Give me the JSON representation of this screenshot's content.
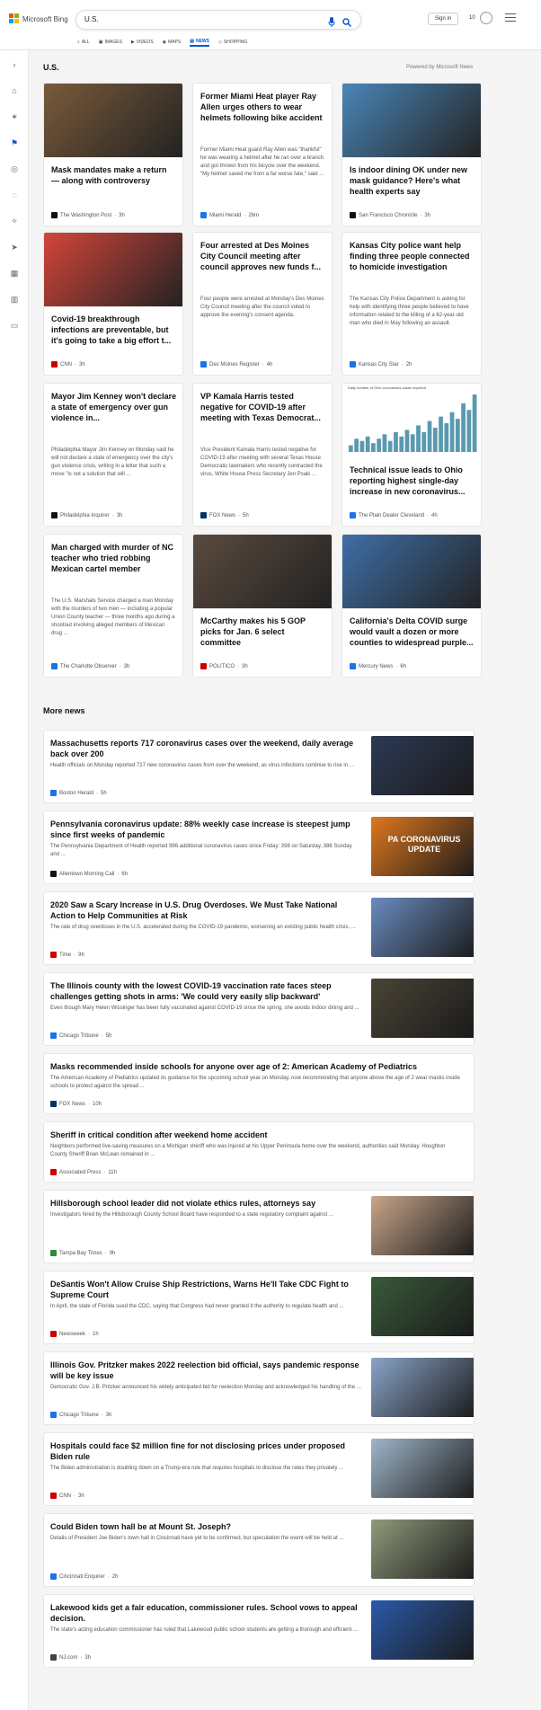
{
  "header": {
    "brand": "Microsoft Bing",
    "search_query": "U.S.",
    "signin_label": "Sign in",
    "rewards_count": "10",
    "tabs": [
      {
        "label": "ALL",
        "icon": "search-icon"
      },
      {
        "label": "IMAGES",
        "icon": "image-icon"
      },
      {
        "label": "VIDEOS",
        "icon": "video-icon"
      },
      {
        "label": "MAPS",
        "icon": "map-pin-icon"
      },
      {
        "label": "NEWS",
        "icon": "news-icon",
        "active": true
      },
      {
        "label": "SHOPPING",
        "icon": "tag-icon"
      }
    ]
  },
  "rail": [
    "chevron-right-icon",
    "home-icon",
    "compass-icon",
    "flag-icon",
    "location-icon",
    "globe-icon",
    "lightbulb-icon",
    "rocket-icon",
    "film-icon",
    "bank-icon",
    "card-icon"
  ],
  "section": {
    "title": "U.S.",
    "powered_by": "Powered by Microsoft News"
  },
  "cards": [
    {
      "title": "Mask mandates make a return — along with controversy",
      "snippet": "",
      "source": "The Washington Post",
      "time": "3h",
      "image": true,
      "color": "#7a5a3a",
      "logo_color": "#111"
    },
    {
      "title": "Former Miami Heat player Ray Allen urges others to wear helmets following bike accident",
      "snippet": "Former Miami Heat guard Ray Allen was \"thankful\" he was wearing a helmet after he ran over a branch and got thrown from his bicycle over the weekend. \"My helmet saved me from a far worse fate,\" said ...",
      "source": "Miami Herald",
      "time": "26m",
      "image": false,
      "logo_color": "#1a73e8"
    },
    {
      "title": "Is indoor dining OK under new mask guidance? Here's what health experts say",
      "snippet": "",
      "source": "San Francisco Chronicle",
      "time": "3h",
      "image": true,
      "color": "#4a86b8",
      "logo_color": "#111"
    },
    {
      "title": "Covid-19 breakthrough infections are preventable, but it's going to take a big effort t...",
      "snippet": "",
      "source": "CNN",
      "time": "3h",
      "image": true,
      "color": "#d4453a",
      "logo_color": "#cc0000"
    },
    {
      "title": "Four arrested at Des Moines City Council meeting after council approves new funds f...",
      "snippet": "Four people were arrested at Monday's Des Moines City Council meeting after the council voted to approve the evening's consent agenda.",
      "source": "Des Moines Register",
      "time": "4h",
      "image": false,
      "logo_color": "#1a73e8"
    },
    {
      "title": "Kansas City police want help finding three people connected to homicide investigation",
      "snippet": "The Kansas City Police Department is asking for help with identifying three people believed to have information related to the killing of a 62-year-old man who died in May following an assault.",
      "source": "Kansas City Star",
      "time": "2h",
      "image": false,
      "logo_color": "#1a73e8"
    },
    {
      "title": "Mayor Jim Kenney won't declare a state of emergency over gun violence in...",
      "snippet": "Philadelphia Mayor Jim Kenney on Monday said he will not declare a state of emergency over the city's gun violence crisis, writing in a letter that such a move \"is not a solution that will ...",
      "source": "Philadelphia Inquirer",
      "time": "3h",
      "image": false,
      "logo_color": "#111"
    },
    {
      "title": "VP Kamala Harris tested negative for COVID-19 after meeting with Texas Democrat...",
      "snippet": "Vice President Kamala Harris tested negative for COVID-19 after meeting with several Texas House Democratic lawmakers who recently contracted the virus, White House Press Secretary Jen Psaki ...",
      "source": "FOX News",
      "time": "5h",
      "image": false,
      "logo_color": "#003366"
    },
    {
      "title": "Technical issue leads to Ohio reporting highest single-day increase in new coronavirus...",
      "snippet": "",
      "source": "The Plain Dealer Cleveland",
      "time": "4h",
      "image": true,
      "chart": true,
      "chart_caption": "Daily number of Ohio coronavirus cases reported",
      "logo_color": "#1a73e8"
    },
    {
      "title": "Man charged with murder of NC teacher who tried robbing Mexican cartel member",
      "snippet": "The U.S. Marshals Service charged a man Monday with the murders of two men — including a popular Union County teacher — three months ago during a shootout involving alleged members of Mexican drug ...",
      "source": "The Charlotte Observer",
      "time": "3h",
      "image": false,
      "logo_color": "#1a73e8"
    },
    {
      "title": "McCarthy makes his 5 GOP picks for Jan. 6 select committee",
      "snippet": "",
      "source": "POLITICO",
      "time": "3h",
      "image": true,
      "color": "#5a4a3e",
      "logo_color": "#cc0000"
    },
    {
      "title": "California's Delta COVID surge would vault a dozen or more counties to widespread purple...",
      "snippet": "",
      "source": "Mercury News",
      "time": "6h",
      "image": true,
      "color": "#3f6fa8",
      "logo_color": "#1a73e8"
    }
  ],
  "more_news": {
    "title": "More news",
    "items": [
      {
        "title": "Massachusetts reports 717 coronavirus cases over the weekend, daily average back over 200",
        "snippet": "Health officials on Monday reported 717 new coronavirus cases from over the weekend, as virus infections continue to rise in ...",
        "source": "Boston Herald",
        "time": "5h",
        "image": true,
        "color": "#2d3a55",
        "logo_color": "#1a73e8"
      },
      {
        "title": "Pennsylvania coronavirus update: 88% weekly case increase is steepest jump since first weeks of pandemic",
        "snippet": "The Pennsylvania Department of Health reported 996 additional coronavirus cases since Friday: 398 on Saturday, 386 Sunday and ...",
        "source": "Allentown Morning Call",
        "time": "6h",
        "image": true,
        "color": "#e0781e",
        "thumb_text": "PA CORONAVIRUS UPDATE",
        "logo_color": "#111"
      },
      {
        "title": "2020 Saw a Scary Increase in U.S. Drug Overdoses. We Must Take National Action to Help Communities at Risk",
        "snippet": "The rate of drug overdoses in the U.S. accelerated during the COVID-19 pandemic, worsening an existing public health crisis, ...",
        "source": "Time",
        "time": "9h",
        "image": true,
        "color": "#6a8cc0",
        "logo_color": "#cc0000"
      },
      {
        "title": "The Illinois county with the lowest COVID-19 vaccination rate faces steep challenges getting shots in arms: 'We could very easily slip backward'",
        "snippet": "Even though Mary Helen Wissinger has been fully vaccinated against COVID-19 since the spring, she avoids indoor dining and ...",
        "source": "Chicago Tribune",
        "time": "5h",
        "image": true,
        "color": "#4a4436",
        "logo_color": "#1a73e8"
      },
      {
        "title": "Masks recommended inside schools for anyone over age of 2: American Academy of Pediatrics",
        "snippet": "The American Academy of Pediatrics updated its guidance for the upcoming school year on Monday, now recommending that anyone above the age of 2 wear masks inside schools to protect against the spread ...",
        "source": "FOX News",
        "time": "10h",
        "image": false,
        "logo_color": "#003366"
      },
      {
        "title": "Sheriff in critical condition after weekend home accident",
        "snippet": "Neighbors performed live-saving measures on a Michigan sheriff who was injured at his Upper Peninsula home over the weekend, authorities said Monday. Houghton County Sheriff Brian McLean remained in ...",
        "source": "Associated Press",
        "time": "11h",
        "image": false,
        "logo_color": "#cc0000"
      },
      {
        "title": "Hillsborough school leader did not violate ethics rules, attorneys say",
        "snippet": "Investigators hired by the Hillsborough County School Board have responded to a state regulatory complaint against ...",
        "source": "Tampa Bay Times",
        "time": "9h",
        "image": true,
        "color": "#c9a58a",
        "logo_color": "#2b8a3e"
      },
      {
        "title": "DeSantis Won't Allow Cruise Ship Restrictions, Warns He'll Take CDC Fight to Supreme Court",
        "snippet": "In April, the state of Florida sued the CDC, saying that Congress had never granted it the authority to regulate health and ...",
        "source": "Newsweek",
        "time": "1h",
        "image": true,
        "color": "#3a5a3a",
        "logo_color": "#cc0000"
      },
      {
        "title": "Illinois Gov. Pritzker makes 2022 reelection bid official, says pandemic response will be key issue",
        "snippet": "Democratic Gov. J.B. Pritzker announced his widely anticipated bid for reelection Monday and acknowledged his handling of the ...",
        "source": "Chicago Tribune",
        "time": "3h",
        "image": true,
        "color": "#8aa4c8",
        "logo_color": "#1a73e8"
      },
      {
        "title": "Hospitals could face $2 million fine for not disclosing prices under proposed Biden rule",
        "snippet": "The Biden administration is doubling down on a Trump-era rule that requires hospitals to disclose the rates they privately ...",
        "source": "CNN",
        "time": "3h",
        "image": true,
        "color": "#9fb6c9",
        "logo_color": "#cc0000"
      },
      {
        "title": "Could Biden town hall be at Mount St. Joseph?",
        "snippet": "Details of President Joe Biden's town hall in Cincinnati have yet to be confirmed, but speculation the event will be held at ...",
        "source": "Cincinnati Enquirer",
        "time": "2h",
        "image": true,
        "color": "#8f9a7a",
        "logo_color": "#1a73e8"
      },
      {
        "title": "Lakewood kids get a fair education, commissioner rules. School vows to appeal decision.",
        "snippet": "The state's acting education commissioner has ruled that Lakewood public school students are getting a thorough and efficient ...",
        "source": "NJ.com",
        "time": "3h",
        "image": true,
        "color": "#2a5aa8",
        "logo_color": "#444"
      }
    ]
  },
  "chart_data": {
    "type": "bar",
    "title": "Daily number of Ohio coronavirus cases reported",
    "values": [
      3,
      6,
      5,
      7,
      4,
      6,
      8,
      5,
      9,
      7,
      10,
      8,
      12,
      9,
      14,
      11,
      16,
      13,
      18,
      15,
      22,
      19,
      26
    ]
  }
}
